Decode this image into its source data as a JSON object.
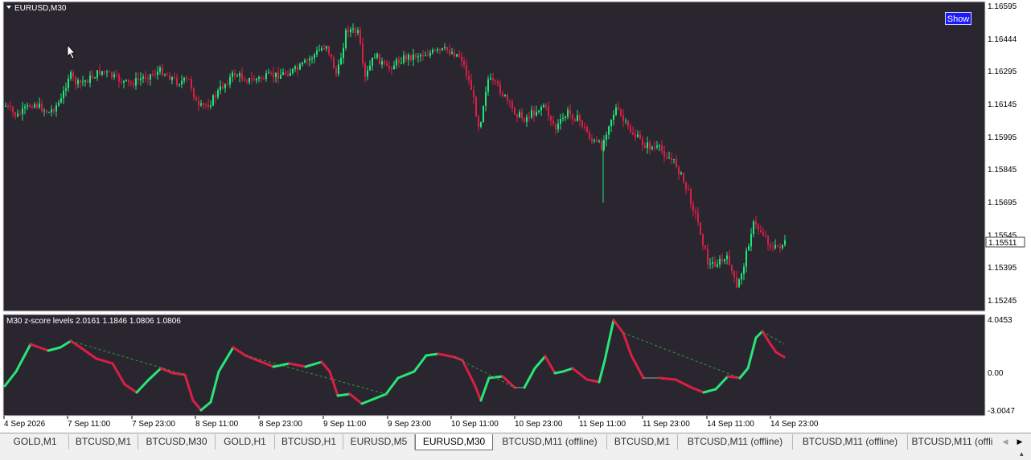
{
  "main_chart": {
    "symbol_label": "EURUSD,M30",
    "price_labels": [
      "1.16595",
      "1.16444",
      "1.16295",
      "1.16145",
      "1.15995",
      "1.15845",
      "1.15695",
      "1.15545",
      "1.15395",
      "1.15245"
    ],
    "current_price": "1.15511",
    "show_button": "Show",
    "colors": {
      "background": "#2a2630",
      "bull": "#1ee87a",
      "bear": "#dc1e44",
      "grid_bg": "#ffffff"
    }
  },
  "indicator": {
    "label": "M30  z-score levels  2.0161 1.1846 1.0806 1.0806",
    "scale_labels": [
      "4.0453",
      "0.00",
      "-3.0047"
    ],
    "colors": {
      "up": "#28e676",
      "down": "#dc1e44",
      "neutral": "#a0a0a0",
      "dashed": "#28a040"
    }
  },
  "time_axis": [
    "4 Sep 2026",
    "7 Sep 11:00",
    "7 Sep 23:00",
    "8 Sep 11:00",
    "8 Sep 23:00",
    "9 Sep 11:00",
    "9 Sep 23:00",
    "10 Sep 11:00",
    "10 Sep 23:00",
    "11 Sep 11:00",
    "11 Sep 23:00",
    "14 Sep 11:00",
    "14 Sep 23:00"
  ],
  "tabs": [
    {
      "label": "GOLD,M1",
      "active": false
    },
    {
      "label": "BTCUSD,M1",
      "active": false
    },
    {
      "label": "BTCUSD,M30",
      "active": false
    },
    {
      "label": "GOLD,H1",
      "active": false
    },
    {
      "label": "BTCUSD,H1",
      "active": false
    },
    {
      "label": "EURUSD,M5",
      "active": false
    },
    {
      "label": "EURUSD,M30",
      "active": true
    },
    {
      "label": "BTCUSD,M11 (offline)",
      "active": false
    },
    {
      "label": "BTCUSD,M1",
      "active": false
    },
    {
      "label": "BTCUSD,M11 (offline)",
      "active": false
    },
    {
      "label": "BTCUSD,M11 (offline)",
      "active": false
    },
    {
      "label": "BTCUSD,M11 (offli",
      "active": false
    }
  ],
  "tab_scroll": {
    "left": "◀",
    "right": "▶"
  },
  "status_icon": "▴"
}
